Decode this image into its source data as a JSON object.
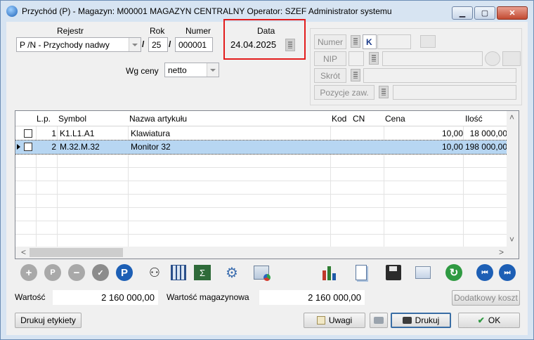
{
  "window": {
    "title": "Przychód (P)  - Magazyn: M00001 MAGAZYN CENTRALNY  Operator: SZEF Administrator systemu"
  },
  "header": {
    "rejestr_label": "Rejestr",
    "rejestr_value": "P /N   - Przychody nadwy",
    "rok_label": "Rok",
    "rok_value": "25",
    "numer_label": "Numer",
    "numer_value": "000001",
    "slash": "/",
    "data_label": "Data",
    "data_value": "24.04.2025",
    "wg_ceny_label": "Wg ceny",
    "wg_ceny_value": "netto"
  },
  "contractor": {
    "numer_label": "Numer",
    "numer_k": "K",
    "nip_label": "NIP",
    "skrot_label": "Skrót",
    "pozycje_label": "Pozycje zaw."
  },
  "table": {
    "columns": [
      "L.p.",
      "Symbol",
      "Nazwa artykułu",
      "Kod",
      "CN",
      "Cena",
      "Ilość"
    ],
    "rows": [
      {
        "lp": "1",
        "symbol": "K1.L1.A1",
        "nazwa": "Klawiatura",
        "kod": "",
        "cn": "",
        "cena": "10,00",
        "ilosc": "18 000,00"
      },
      {
        "lp": "2",
        "symbol": "M.32.M.32",
        "nazwa": "Monitor 32",
        "kod": "",
        "cn": "",
        "cena": "10,00",
        "ilosc": "198 000,00"
      }
    ]
  },
  "toolbar": {
    "icons": [
      "add-icon",
      "preview-icon",
      "remove-icon",
      "check-icon",
      "p-icon",
      "binoculars-icon",
      "calculator-grid-icon",
      "sum-icon",
      "gears-icon",
      "chart-pie-icon",
      "bar-chart-icon",
      "document-icon",
      "save-icon",
      "copy-icon",
      "refresh-icon",
      "first-icon",
      "last-icon"
    ]
  },
  "totals": {
    "wartosc_label": "Wartość",
    "wartosc_value": "2 160 000,00",
    "wartosc_mag_label": "Wartość magazynowa",
    "wartosc_mag_value": "2 160 000,00",
    "dodatkowy_koszt": "Dodatkowy koszt"
  },
  "buttons": {
    "drukuj_etykiety": "Drukuj etykiety",
    "uwagi": "Uwagi",
    "drukuj": "Drukuj",
    "ok": "OK"
  }
}
